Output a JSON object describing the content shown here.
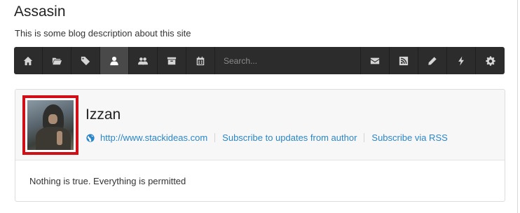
{
  "blog": {
    "title": "Assasin",
    "description": "This is some blog description about this site"
  },
  "toolbar": {
    "search_placeholder": "Search...",
    "left_icons": [
      "home-icon",
      "folder-icon",
      "tags-icon",
      "user-icon",
      "users-icon",
      "archive-icon",
      "calendar-icon"
    ],
    "right_icons": [
      "envelope-icon",
      "rss-icon",
      "pencil-icon",
      "bolt-icon",
      "gear-icon"
    ],
    "active_icon": "user-icon"
  },
  "author": {
    "name": "Izzan",
    "website": "http://www.stackideas.com",
    "subscribe_updates": "Subscribe to updates from author",
    "subscribe_rss": "Subscribe via RSS",
    "bio": "Nothing is true. Everything is permitted"
  },
  "colors": {
    "toolbar_bg": "#2c2c2c",
    "active_bg": "#494949",
    "link": "#2a86c8",
    "avatar_highlight": "#d10f16"
  }
}
